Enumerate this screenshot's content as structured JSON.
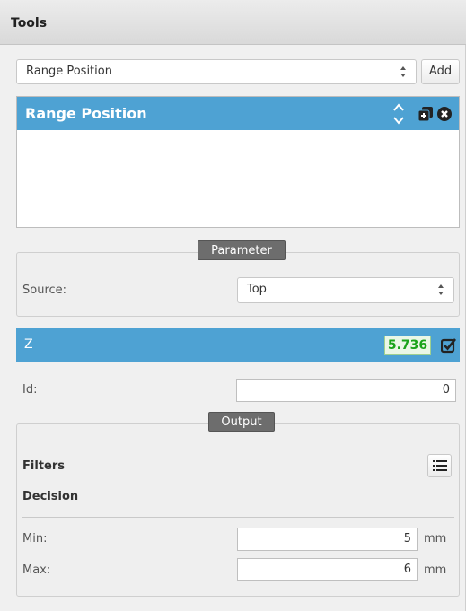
{
  "header": {
    "title": "Tools"
  },
  "tool_select": {
    "value": "Range Position"
  },
  "add_button": {
    "label": "Add"
  },
  "tool_panel": {
    "title": "Range Position"
  },
  "parameter": {
    "legend": "Parameter",
    "source_label": "Source:",
    "source_value": "Top"
  },
  "measurement": {
    "label": "Z",
    "value": "5.736",
    "id_label": "Id:",
    "id_value": "0"
  },
  "output": {
    "legend": "Output",
    "filters_label": "Filters",
    "decision_label": "Decision",
    "min_label": "Min:",
    "min_value": "5",
    "max_label": "Max:",
    "max_value": "6",
    "unit": "mm"
  },
  "colors": {
    "accent": "#4ea2d3",
    "value_ok": "#1aa31a"
  }
}
